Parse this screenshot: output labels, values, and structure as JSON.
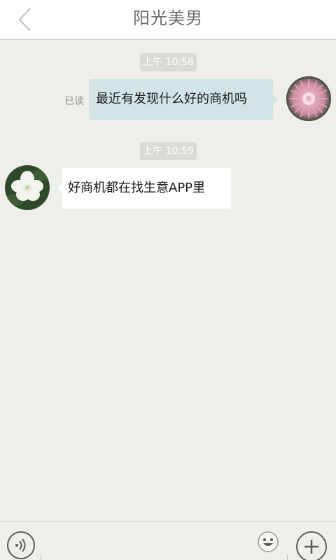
{
  "header": {
    "title": "阳光美男",
    "back_icon": "chevron-left-icon"
  },
  "messages": [
    {
      "time": "上午 10:58",
      "direction": "outgoing",
      "text": "最近有发现什么好的商机吗",
      "read_status": "已读",
      "avatar": "pink-flower-avatar"
    },
    {
      "time": "上午 10:59",
      "direction": "incoming",
      "text": "好商机都在找生意APP里",
      "avatar": "white-flower-avatar"
    }
  ],
  "input_bar": {
    "voice_icon": "voice-icon",
    "text_value": "",
    "emoji_icon": "emoji-icon",
    "plus_icon": "plus-icon"
  },
  "colors": {
    "background": "#f0eeea",
    "outgoing_bubble": "#d2e4e6",
    "incoming_bubble": "#ffffff",
    "time_chip": "#dcdad6"
  }
}
